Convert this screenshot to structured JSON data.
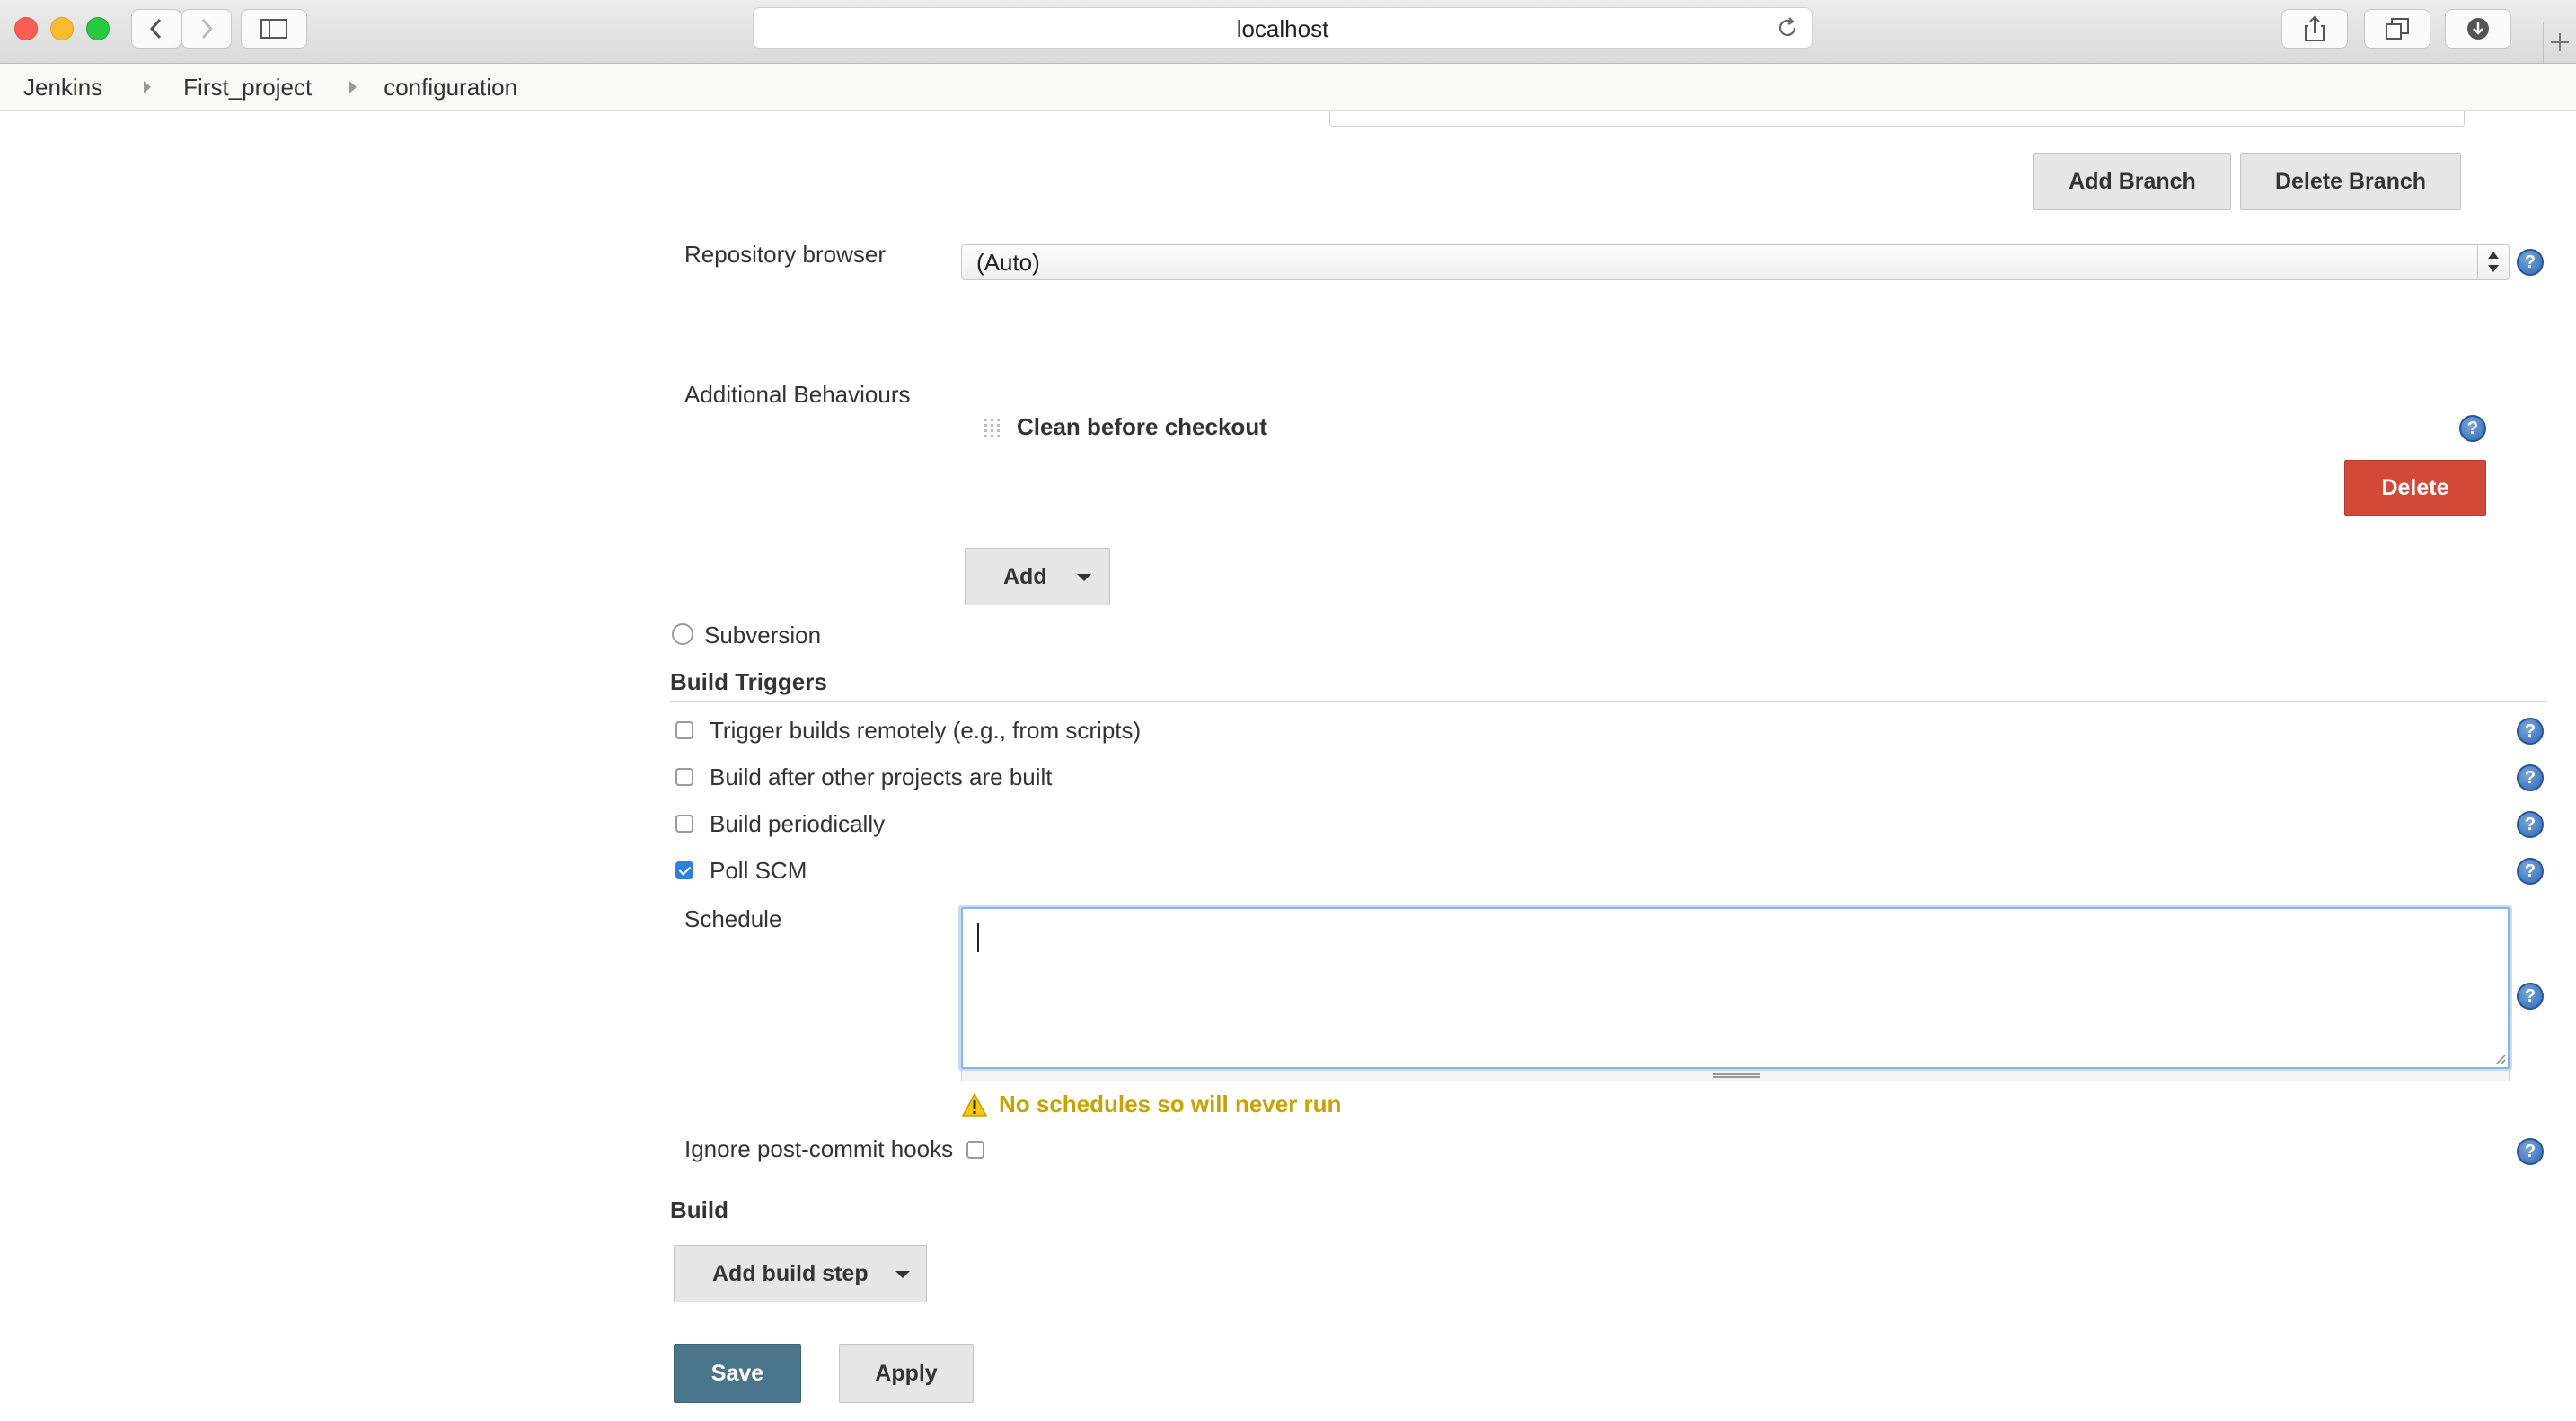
{
  "browser": {
    "url": "localhost"
  },
  "breadcrumb": {
    "items": [
      "Jenkins",
      "First_project",
      "configuration"
    ]
  },
  "scm": {
    "add_branch_label": "Add Branch",
    "delete_branch_label": "Delete Branch",
    "repo_browser_label": "Repository browser",
    "repo_browser_value": "(Auto)",
    "additional_behaviours_label": "Additional Behaviours",
    "behaviour_title": "Clean before checkout",
    "delete_label": "Delete",
    "add_label": "Add",
    "subversion_label": "Subversion"
  },
  "build_triggers": {
    "title": "Build Triggers",
    "options": [
      {
        "label": "Trigger builds remotely (e.g., from scripts)",
        "checked": false
      },
      {
        "label": "Build after other projects are built",
        "checked": false
      },
      {
        "label": "Build periodically",
        "checked": false
      },
      {
        "label": "Poll SCM",
        "checked": true
      }
    ],
    "schedule_label": "Schedule",
    "schedule_value": "",
    "warning": "No schedules so will never run",
    "ignore_hooks_label": "Ignore post-commit hooks"
  },
  "build": {
    "title": "Build",
    "add_step_label": "Add build step"
  },
  "footer": {
    "save_label": "Save",
    "apply_label": "Apply"
  },
  "colors": {
    "delete": "#d24939",
    "save": "#4b758b",
    "warning": "#c9a100",
    "help": "#2f67b5"
  }
}
